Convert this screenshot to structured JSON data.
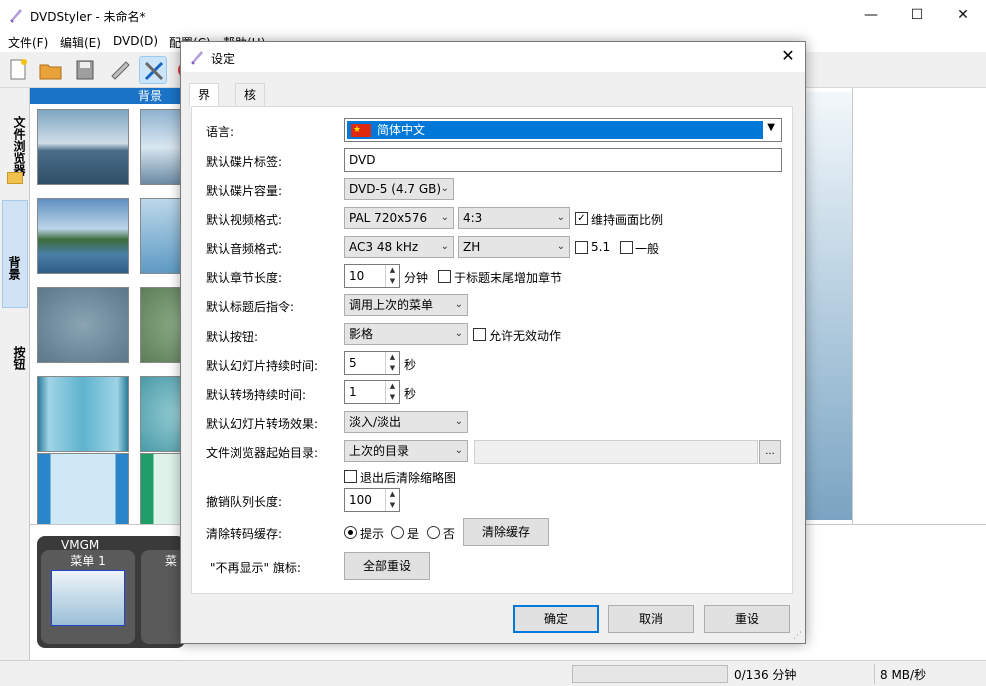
{
  "window": {
    "title": "DVDStyler - 未命名*",
    "minimize": "—",
    "maximize": "☐",
    "close": "✕"
  },
  "menubar": [
    "文件(F)",
    "编辑(E)",
    "DVD(D)",
    "配置(C)",
    "帮助(H)"
  ],
  "side_tabs": [
    "文件浏览器",
    "背景",
    "按钮"
  ],
  "browser_header": "背景",
  "menus_panel": {
    "vmgm_label": "VMGM",
    "menu1": "菜单 1",
    "menu2_partial": "菜"
  },
  "status": {
    "duration": "0/136 分钟",
    "rate": "8 MB/秒"
  },
  "dialog": {
    "title": "设定",
    "close": "✕",
    "tabs": [
      "界面",
      "核心"
    ],
    "language_label": "语言:",
    "language_value": "简体中文",
    "disc_label_label": "默认碟片标签:",
    "disc_label_value": "DVD",
    "disc_capacity_label": "默认碟片容量:",
    "disc_capacity_value": "DVD-5 (4.7 GB)",
    "video_format_label": "默认视频格式:",
    "video_format_value": "PAL 720x576",
    "aspect_value": "4:3",
    "keep_aspect_label": "维持画面比例",
    "audio_format_label": "默认音频格式:",
    "audio_format_value": "AC3 48 kHz",
    "audio_lang_value": "ZH",
    "audio_51_label": "5.1",
    "audio_normal_label": "一般",
    "chapter_len_label": "默认章节长度:",
    "chapter_len_value": "10",
    "chapter_unit": "分钟",
    "chapter_end_label": "于标题末尾增加章节",
    "post_cmd_label": "默认标题后指令:",
    "post_cmd_value": "调用上次的菜单",
    "default_button_label": "默认按钮:",
    "default_button_value": "影格",
    "allow_invalid_label": "允许无效动作",
    "slide_duration_label": "默认幻灯片持续时间:",
    "slide_duration_value": "5",
    "seconds_unit": "秒",
    "transition_duration_label": "默认转场持续时间:",
    "transition_duration_value": "1",
    "transition_effect_label": "默认幻灯片转场效果:",
    "transition_effect_value": "淡入/淡出",
    "browser_dir_label": "文件浏览器起始目录:",
    "browser_dir_value": "上次的目录",
    "browse_button": "...",
    "clear_thumbs_label": "退出后清除缩略图",
    "undo_len_label": "撤销队列长度:",
    "undo_len_value": "100",
    "clear_cache_label": "清除转码缓存:",
    "cache_options": [
      "提示",
      "是",
      "否"
    ],
    "clear_cache_button": "清除缓存",
    "dont_show_label": "\"不再显示\" 旗标:",
    "reset_all_button": "全部重设",
    "ok": "确定",
    "cancel": "取消",
    "reset": "重设"
  }
}
